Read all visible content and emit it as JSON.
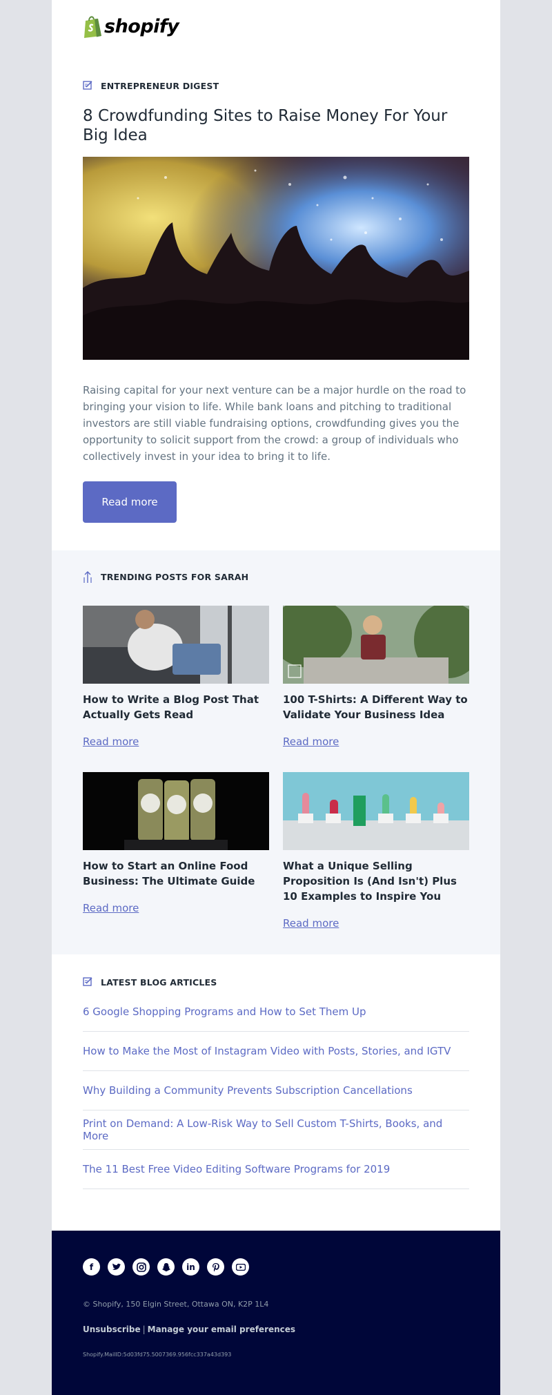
{
  "brand": {
    "name": "shopify"
  },
  "digest": {
    "label": "ENTREPRENEUR DIGEST",
    "title": "8 Crowdfunding Sites to Raise Money For Your Big Idea",
    "body": "Raising capital for your next venture can be a major hurdle on the road to bringing your vision to life. While bank loans and pitching to traditional investors are still viable fundraising options, crowdfunding gives you the opportunity to solicit support from the crowd: a group of individuals who collectively invest in your idea to bring it to life.",
    "button": "Read more"
  },
  "trending": {
    "label": "TRENDING POSTS FOR SARAH",
    "posts": [
      {
        "title": "How to Write a Blog Post That Actually Gets Read",
        "link": "Read more"
      },
      {
        "title": "100 T-Shirts: A Different Way to Validate Your Business Idea",
        "link": "Read more"
      },
      {
        "title": "How to Start an Online Food Business: The Ultimate Guide",
        "link": "Read more"
      },
      {
        "title": "What a Unique Selling Proposition Is (And Isn't) Plus 10 Examples to Inspire You",
        "link": "Read more"
      }
    ]
  },
  "latest": {
    "label": "LATEST BLOG ARTICLES",
    "articles": [
      "6 Google Shopping Programs and How to Set Them Up",
      "How to Make the Most of Instagram Video with Posts, Stories, and IGTV",
      "Why Building a Community Prevents Subscription Cancellations",
      "Print on Demand: A Low-Risk Way to Sell Custom T-Shirts, Books, and More",
      "The 11 Best Free Video Editing Software Programs for 2019"
    ]
  },
  "footer": {
    "social_icons": [
      "facebook-icon",
      "twitter-icon",
      "instagram-icon",
      "snapchat-icon",
      "linkedin-icon",
      "pinterest-icon",
      "youtube-icon"
    ],
    "address": "© Shopify,  150 Elgin Street, Ottawa ON, K2P 1L4",
    "unsubscribe": "Unsubscribe",
    "separator": "|",
    "manage": "Manage your email preferences",
    "mail_id": "Shopify.MailID:5d03fd75.5007369.956fcc337a43d393"
  },
  "colors": {
    "accent": "#5c6ac4",
    "footer_bg": "#000639",
    "trending_bg": "#f4f6fa",
    "page_bg": "#e1e3e8"
  }
}
